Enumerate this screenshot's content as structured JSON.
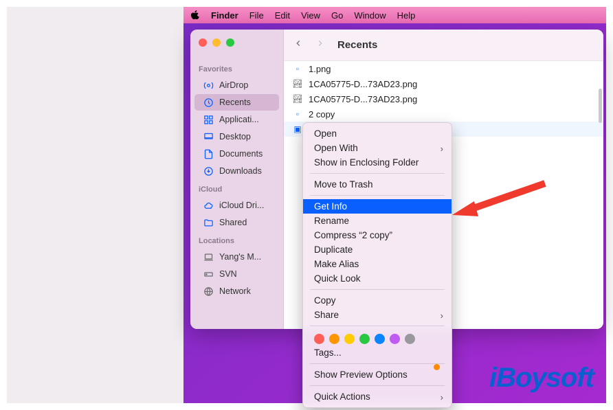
{
  "menubar": {
    "app": "Finder",
    "items": [
      "File",
      "Edit",
      "View",
      "Go",
      "Window",
      "Help"
    ]
  },
  "window": {
    "title": "Recents"
  },
  "sidebar": {
    "sections": [
      {
        "header": "Favorites",
        "items": [
          {
            "icon": "airdrop",
            "label": "AirDrop"
          },
          {
            "icon": "recents",
            "label": "Recents",
            "selected": true
          },
          {
            "icon": "apps",
            "label": "Applicati..."
          },
          {
            "icon": "desktop",
            "label": "Desktop"
          },
          {
            "icon": "documents",
            "label": "Documents"
          },
          {
            "icon": "downloads",
            "label": "Downloads"
          }
        ]
      },
      {
        "header": "iCloud",
        "items": [
          {
            "icon": "icloud",
            "label": "iCloud Dri..."
          },
          {
            "icon": "shared",
            "label": "Shared"
          }
        ]
      },
      {
        "header": "Locations",
        "items": [
          {
            "icon": "mac",
            "label": "Yang's M..."
          },
          {
            "icon": "drive",
            "label": "SVN"
          },
          {
            "icon": "network",
            "label": "Network"
          }
        ]
      }
    ]
  },
  "files": [
    {
      "icon": "folder",
      "name": "1.png"
    },
    {
      "icon": "image",
      "name": "1CA05775-D...73AD23.png"
    },
    {
      "icon": "image",
      "name": "1CA05775-D...73AD23.png"
    },
    {
      "icon": "folder",
      "name": "2 copy"
    },
    {
      "icon": "blue",
      "name": "",
      "selected": true
    }
  ],
  "context_menu": {
    "groups": [
      [
        {
          "label": "Open"
        },
        {
          "label": "Open With",
          "submenu": true
        },
        {
          "label": "Show in Enclosing Folder"
        }
      ],
      [
        {
          "label": "Move to Trash"
        }
      ],
      [
        {
          "label": "Get Info",
          "highlighted": true
        },
        {
          "label": "Rename"
        },
        {
          "label": "Compress “2 copy”"
        },
        {
          "label": "Duplicate"
        },
        {
          "label": "Make Alias"
        },
        {
          "label": "Quick Look"
        }
      ],
      [
        {
          "label": "Copy"
        },
        {
          "label": "Share",
          "submenu": true
        }
      ]
    ],
    "tag_colors": [
      "#ff5f57",
      "#ff9500",
      "#ffcc00",
      "#28c840",
      "#0a84ff",
      "#bf5af2",
      "#98989d"
    ],
    "tags_label": "Tags...",
    "extra": [
      "Show Preview Options",
      "Quick Actions"
    ]
  },
  "watermark": "iBoysoft"
}
